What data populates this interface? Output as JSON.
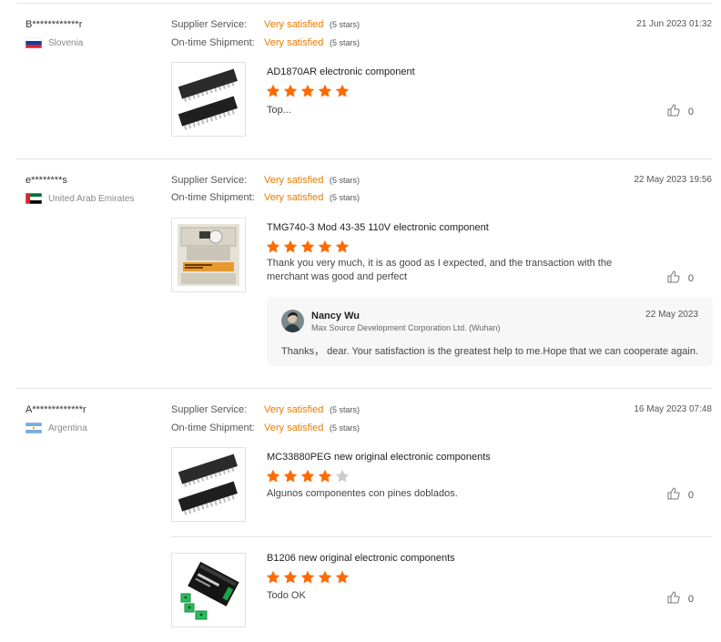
{
  "reviews": [
    {
      "buyer": "B************r",
      "country": "Slovenia",
      "date": "21 Jun 2023 01:32",
      "ratings": [
        {
          "label": "Supplier Service:",
          "value": "Very satisfied",
          "stars_text": "(5 stars)"
        },
        {
          "label": "On-time Shipment:",
          "value": "Very satisfied",
          "stars_text": "(5 stars)"
        }
      ],
      "items": [
        {
          "title": "AD1870AR electronic component",
          "rating": 5,
          "comment": "Top...",
          "likes": "0"
        }
      ]
    },
    {
      "buyer": "e********s",
      "country": "United Arab Emirates",
      "date": "22 May 2023 19:56",
      "ratings": [
        {
          "label": "Supplier Service:",
          "value": "Very satisfied",
          "stars_text": "(5 stars)"
        },
        {
          "label": "On-time Shipment:",
          "value": "Very satisfied",
          "stars_text": "(5 stars)"
        }
      ],
      "items": [
        {
          "title": "TMG740-3 Mod 43-35 110V electronic component",
          "rating": 5,
          "comment": "Thank you very much, it is as good as I expected, and the transaction with the merchant was good and perfect",
          "likes": "0"
        }
      ],
      "reply": {
        "name": "Nancy Wu",
        "company": "Max Source Development Corporation Ltd. (Wuhan)",
        "date": "22 May 2023",
        "text": "Thanks， dear. Your satisfaction is the greatest help to me.Hope that we can cooperate again."
      }
    },
    {
      "buyer": "A*************r",
      "country": "Argentina",
      "date": "16 May 2023 07:48",
      "ratings": [
        {
          "label": "Supplier Service:",
          "value": "Very satisfied",
          "stars_text": "(5 stars)"
        },
        {
          "label": "On-time Shipment:",
          "value": "Very satisfied",
          "stars_text": "(5 stars)"
        }
      ],
      "items": [
        {
          "title": "MC33880PEG new original electronic components",
          "rating": 4,
          "comment": "Algunos componentes con pines doblados.",
          "likes": "0"
        },
        {
          "title": "B1206 new original electronic components",
          "rating": 5,
          "comment": "Todo OK",
          "likes": "0"
        }
      ]
    }
  ],
  "colors": {
    "accent": "#ff6a00",
    "star_empty": "#cccccc",
    "satisfied": "#e97a00"
  },
  "icons": {
    "like": "thumbs-up-icon",
    "star": "star-icon"
  }
}
